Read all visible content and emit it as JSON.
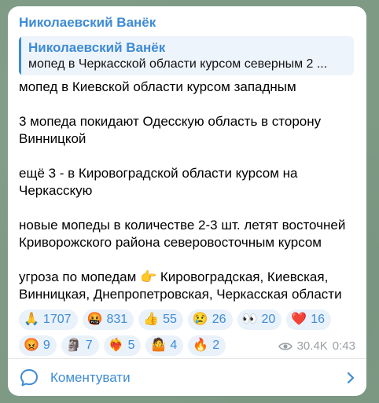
{
  "post": {
    "channel_name": "Николаевский Ванёк",
    "reply": {
      "author": "Николаевский Ванёк",
      "text": "мопед в Черкасской области курсом северным  2 ..."
    },
    "paragraphs": [
      "мопед в Киевской области курсом западным",
      "3 мопеда покидают Одесскую область в сторону Винницкой",
      "ещё 3 - в Кировоградской области курсом на Черкасскую",
      "новые мопеды в количестве 2-3 шт. летят восточней Криворожского района северовосточным курсом",
      "угроза по мопедам 👉 Кировоградская, Киевская, Винницкая, Днепропетровская, Черкасская области"
    ],
    "reactions_row1": [
      {
        "emoji": "🙏",
        "count": "1707",
        "icon": "praying-hands-icon"
      },
      {
        "emoji": "🤬",
        "count": "831",
        "icon": "cursing-face-icon"
      },
      {
        "emoji": "👍",
        "count": "55",
        "icon": "thumbs-up-icon"
      },
      {
        "emoji": "😢",
        "count": "26",
        "icon": "crying-face-icon"
      },
      {
        "emoji": "👀",
        "count": "20",
        "icon": "eyes-icon"
      },
      {
        "emoji": "❤️",
        "count": "16",
        "icon": "red-heart-icon"
      }
    ],
    "reactions_row2": [
      {
        "emoji": "😡",
        "count": "9",
        "icon": "angry-face-icon"
      },
      {
        "emoji": "🗿",
        "count": "7",
        "icon": "moai-icon"
      },
      {
        "emoji": "❤️‍🔥",
        "count": "5",
        "icon": "heart-on-fire-icon"
      },
      {
        "emoji": "🤷",
        "count": "4",
        "icon": "shrug-icon"
      },
      {
        "emoji": "🔥",
        "count": "2",
        "icon": "fire-icon"
      }
    ],
    "views": "30.4K",
    "time": "0:43",
    "comments_label": "Коментувати"
  },
  "colors": {
    "accent": "#3d8bd6",
    "background": "#7e9a85",
    "bubble": "#ffffff",
    "meta": "#9aa0a6"
  }
}
